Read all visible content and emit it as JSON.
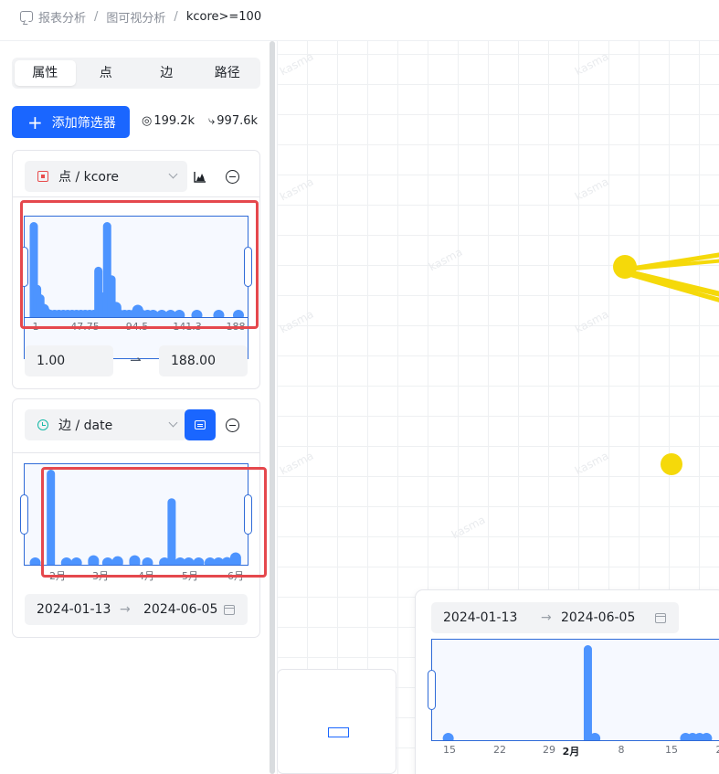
{
  "breadcrumb": {
    "items": [
      "报表分析",
      "图可视分析",
      "kcore>=100"
    ]
  },
  "tabs": [
    "属性",
    "点",
    "边",
    "路径"
  ],
  "add_filter_label": "添加筛选器",
  "stats": {
    "nodes": "199.2k",
    "edges": "997.6k"
  },
  "filters": [
    {
      "field": "点 / kcore",
      "x_ticks": [
        "1",
        "47.75",
        "94.5",
        "141.3",
        "188"
      ],
      "min_value": "1.00",
      "max_value": "188.00"
    },
    {
      "field": "边 / date",
      "x_ticks": [
        "2月",
        "3月",
        "4月",
        "5月",
        "6月"
      ],
      "start_date": "2024-01-13",
      "end_date": "2024-06-05"
    }
  ],
  "timeline": {
    "start_date": "2024-01-13",
    "end_date": "2024-06-05",
    "x_ticks": [
      "15",
      "22",
      "29",
      "2月",
      "8",
      "15",
      "2"
    ]
  },
  "canvas": {
    "watermark": "kasma",
    "node_color": "#f5d90a"
  },
  "colors": {
    "accent": "#1a66ff",
    "bar": "#4d94ff",
    "highlight": "#e5484d"
  },
  "chart_data": [
    {
      "type": "bar",
      "title": "点 / kcore",
      "x": [
        1,
        4,
        7,
        10,
        13,
        16,
        20,
        24,
        28,
        32,
        36,
        40,
        44,
        48,
        52,
        56,
        60,
        64,
        68,
        72,
        76,
        80,
        84,
        88,
        92,
        96,
        100,
        105,
        110,
        118,
        126,
        134,
        150,
        170,
        188
      ],
      "values": [
        100,
        34,
        24,
        14,
        9,
        7,
        6,
        6,
        5,
        5,
        4,
        4,
        4,
        3,
        3,
        3,
        53,
        26,
        100,
        44,
        16,
        7,
        5,
        3,
        3,
        13,
        2,
        3,
        2,
        2,
        1,
        1,
        1,
        1,
        1
      ],
      "xlim": [
        1,
        188
      ]
    },
    {
      "type": "bar",
      "title": "边 / date",
      "x": [
        "2024-01-14",
        "2024-01-25",
        "2024-02-05",
        "2024-02-12",
        "2024-02-24",
        "2024-03-05",
        "2024-03-12",
        "2024-03-24",
        "2024-04-02",
        "2024-04-14",
        "2024-04-19",
        "2024-04-25",
        "2024-05-01",
        "2024-05-08",
        "2024-05-16",
        "2024-05-22",
        "2024-05-28",
        "2024-06-03"
      ],
      "values": [
        5,
        100,
        5,
        5,
        10,
        5,
        9,
        10,
        6,
        5,
        70,
        6,
        5,
        4,
        4,
        5,
        8,
        13
      ],
      "xlim": [
        "2024-01-13",
        "2024-06-05"
      ]
    },
    {
      "type": "bar",
      "title": "",
      "x": [
        "2024-01-14",
        "2024-02-03",
        "2024-02-04",
        "2024-02-17",
        "2024-02-18",
        "2024-02-19",
        "2024-02-20"
      ],
      "values": [
        5,
        100,
        2,
        5,
        3,
        2,
        3
      ],
      "xlim": [
        "2024-01-13",
        "2024-02-21"
      ]
    }
  ]
}
